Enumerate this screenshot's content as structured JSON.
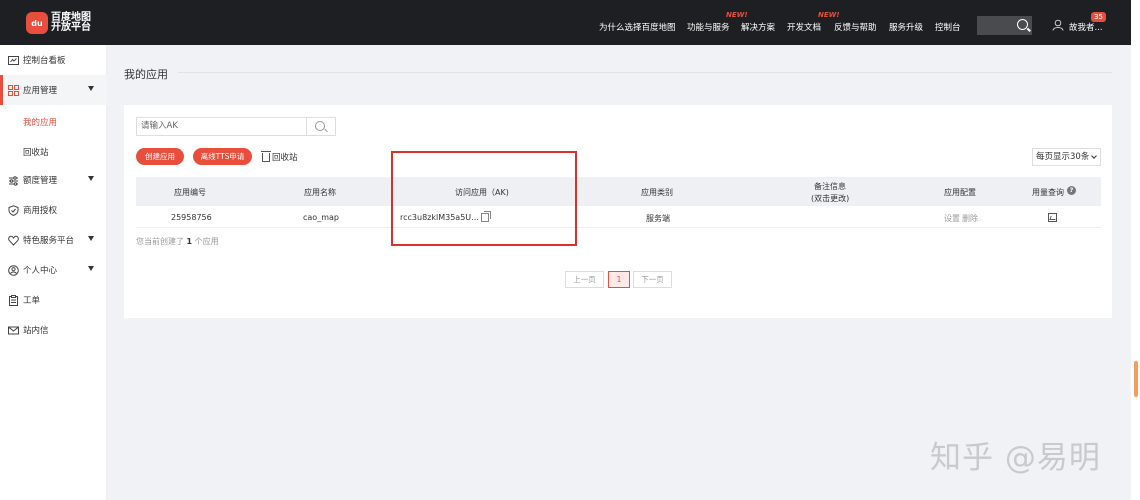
{
  "header": {
    "logo_mark": "du",
    "logo_line1": "百度地图",
    "logo_line2": "开放平台",
    "nav": [
      {
        "label": "为什么选择百度地图"
      },
      {
        "label": "功能与服务",
        "badge": "NEW!"
      },
      {
        "label": "解决方案"
      },
      {
        "label": "开发文档"
      },
      {
        "label": "反馈与帮助",
        "badge": "NEW!"
      },
      {
        "label": "服务升级"
      },
      {
        "label": "控制台"
      }
    ],
    "user_name": "故我者...",
    "user_badge": "35"
  },
  "sidebar": {
    "items": [
      {
        "label": "控制台看板",
        "icon": "dashboard-icon"
      },
      {
        "label": "应用管理",
        "icon": "grid-icon",
        "expanded": true
      },
      {
        "label": "我的应用",
        "sub": true,
        "active": true
      },
      {
        "label": "回收站",
        "sub": true
      },
      {
        "label": "额度管理",
        "icon": "sliders-icon"
      },
      {
        "label": "商用授权",
        "icon": "shield-icon"
      },
      {
        "label": "特色服务平台",
        "icon": "heart-icon"
      },
      {
        "label": "个人中心",
        "icon": "user-circle-icon"
      },
      {
        "label": "工单",
        "icon": "clipboard-icon"
      },
      {
        "label": "站内信",
        "icon": "mail-icon"
      }
    ]
  },
  "main": {
    "title": "我的应用",
    "search_placeholder": "请输入AK",
    "create_button": "创建应用",
    "tts_button": "离线TTS申请",
    "recycle_label": "回收站",
    "page_size": "每页显示30条",
    "table": {
      "headers": [
        "应用编号",
        "应用名称",
        "访问应用（AK)",
        "应用类别",
        "备注信息",
        "(双击更改)",
        "应用配置",
        "用量查询"
      ],
      "rows": [
        {
          "id": "25958756",
          "name": "cao_map",
          "ak": "rcc3u8zklM35a5U...",
          "category": "服务端",
          "note": "",
          "settings": "设置",
          "delete": "删除"
        }
      ]
    },
    "summary_prefix": "您当前创建了",
    "summary_count": "1",
    "summary_suffix": "个应用",
    "pager": {
      "prev": "上一页",
      "current": "1",
      "next": "下一页"
    }
  },
  "watermark": "知乎 @易明",
  "colors": {
    "accent": "#e94e3d",
    "topbar": "#1e1f23",
    "highlight_box": "#d9302a"
  }
}
